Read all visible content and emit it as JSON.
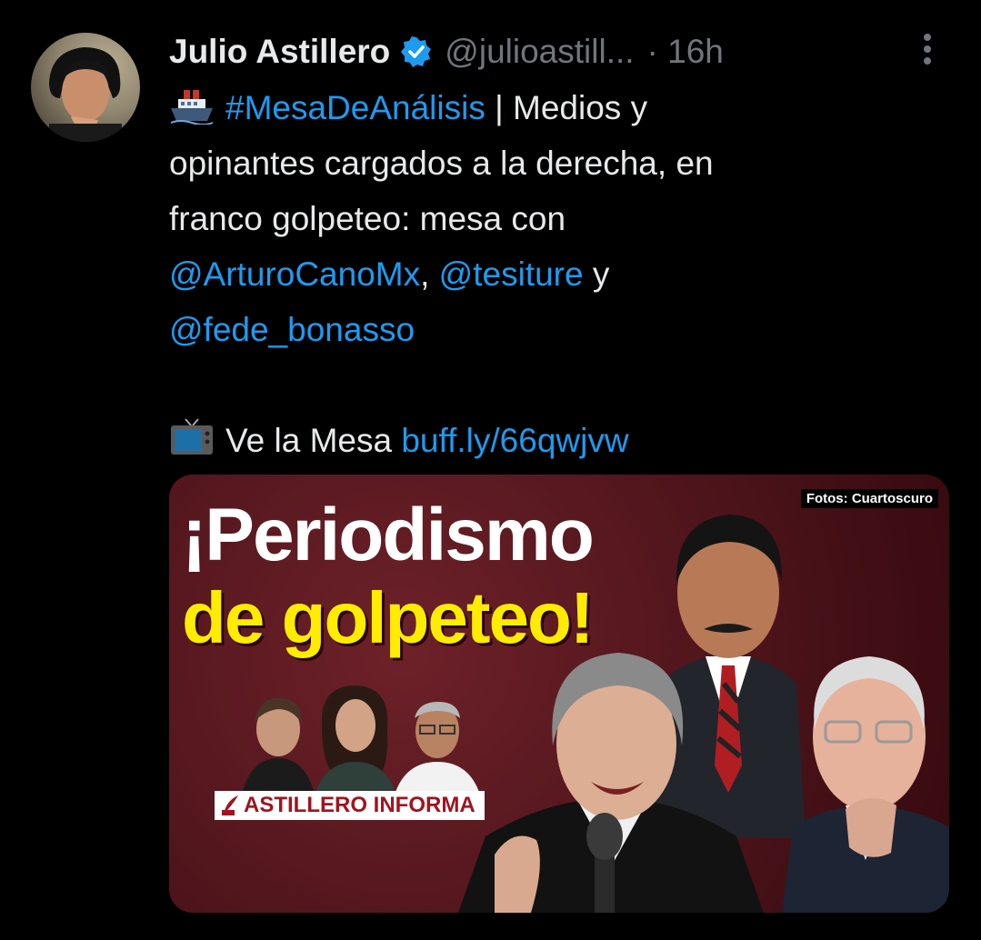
{
  "tweet": {
    "author_name": "Julio Astillero",
    "handle": "@julioastill...",
    "time": "· 16h",
    "hashtag": "#MesaDeAnálisis",
    "text_after_hashtag": " | Medios y",
    "line2": "opinantes cargados a la derecha, en",
    "line3": "franco golpeteo: mesa con",
    "mention1": "@ArturoCanoMx",
    "sep1": ", ",
    "mention2": "@tesiture",
    "sep2": " y",
    "mention3": "@fede_bonasso",
    "watch_label": "Ve la Mesa ",
    "link": "buff.ly/66qwjvw"
  },
  "icons": {
    "ship": "ship-icon",
    "tv": "tv-icon",
    "verified": "verified-badge-icon",
    "more": "more-options-icon"
  },
  "media": {
    "headline_line1": "¡Periodismo",
    "headline_line2": "de golpeteo!",
    "credit": "Fotos: Cuartoscuro",
    "brand": "ASTILLERO INFORMA"
  },
  "colors": {
    "background": "#000000",
    "text": "#e7e9ea",
    "secondary": "#71767b",
    "link": "#1d9bf0",
    "headline_yellow": "#ffec00",
    "media_red": "#4e141b"
  }
}
